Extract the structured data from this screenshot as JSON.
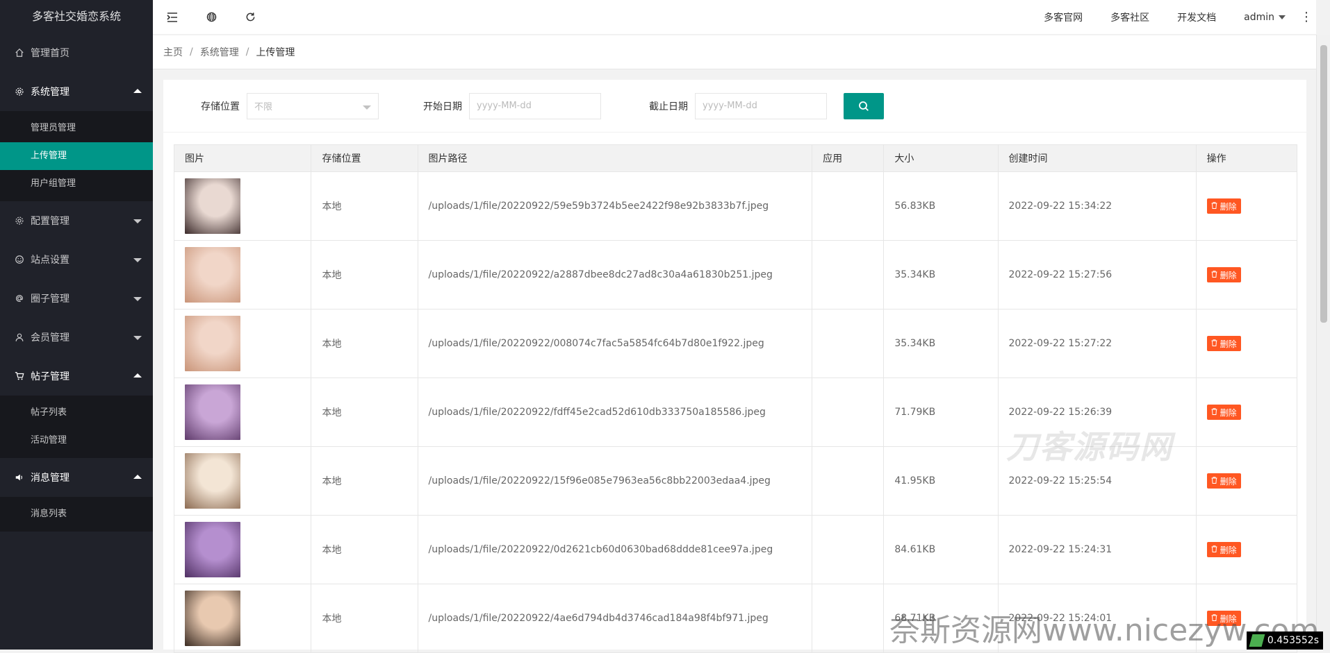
{
  "app": {
    "title": "多客社交婚恋系统"
  },
  "sidebar": {
    "items": [
      {
        "label": "管理首页",
        "icon": "home-icon",
        "expanded": false,
        "has_arrow": false
      },
      {
        "label": "系统管理",
        "icon": "gear-icon",
        "expanded": true,
        "has_arrow": true,
        "children": [
          "管理员管理",
          "上传管理",
          "用户组管理"
        ],
        "active_child": "上传管理"
      },
      {
        "label": "配置管理",
        "icon": "gear-icon",
        "expanded": false,
        "has_arrow": true
      },
      {
        "label": "站点设置",
        "icon": "smile-icon",
        "expanded": false,
        "has_arrow": true
      },
      {
        "label": "圈子管理",
        "icon": "at-icon",
        "expanded": false,
        "has_arrow": true
      },
      {
        "label": "会员管理",
        "icon": "user-icon",
        "expanded": false,
        "has_arrow": true
      },
      {
        "label": "帖子管理",
        "icon": "cart-icon",
        "expanded": true,
        "has_arrow": true,
        "children": [
          "帖子列表",
          "活动管理"
        ]
      },
      {
        "label": "消息管理",
        "icon": "speaker-icon",
        "expanded": true,
        "has_arrow": true,
        "children": [
          "消息列表"
        ]
      }
    ]
  },
  "header": {
    "icons": [
      "menu-fold-icon",
      "globe-icon",
      "refresh-icon"
    ],
    "links": [
      "多客官网",
      "多客社区",
      "开发文档"
    ],
    "user": "admin",
    "more": "⋮"
  },
  "breadcrumb": [
    "主页",
    "系统管理",
    "上传管理"
  ],
  "filters": {
    "storage_label": "存储位置",
    "storage_value": "不限",
    "start_label": "开始日期",
    "start_placeholder": "yyyy-MM-dd",
    "end_label": "截止日期",
    "end_placeholder": "yyyy-MM-dd",
    "search_icon": "search-icon"
  },
  "table": {
    "columns": [
      "图片",
      "存储位置",
      "图片路径",
      "应用",
      "大小",
      "创建时间",
      "操作"
    ],
    "delete_label": "删除",
    "rows": [
      {
        "storage": "本地",
        "path": "/uploads/1/file/20220922/59e59b3724b5ee2422f98e92b3833b7f.jpeg",
        "app": "",
        "size": "56.83KB",
        "created": "2022-09-22 15:34:22",
        "thumb_colors": [
          "#e9d9d2",
          "#3b2a2a"
        ]
      },
      {
        "storage": "本地",
        "path": "/uploads/1/file/20220922/a2887dbee8dc27ad8c30a4a61830b251.jpeg",
        "app": "",
        "size": "35.34KB",
        "created": "2022-09-22 15:27:56",
        "thumb_colors": [
          "#f1d6c8",
          "#c99478"
        ]
      },
      {
        "storage": "本地",
        "path": "/uploads/1/file/20220922/008074c7fac5a5854fc64b7d80e1f922.jpeg",
        "app": "",
        "size": "35.34KB",
        "created": "2022-09-22 15:27:22",
        "thumb_colors": [
          "#f1d6c8",
          "#c99478"
        ]
      },
      {
        "storage": "本地",
        "path": "/uploads/1/file/20220922/fdff45e2cad52d610db333750a185586.jpeg",
        "app": "",
        "size": "71.79KB",
        "created": "2022-09-22 15:26:39",
        "thumb_colors": [
          "#c9a6d6",
          "#5e3a6a"
        ]
      },
      {
        "storage": "本地",
        "path": "/uploads/1/file/20220922/15f96e085e7963ea56c8bb22003edaa4.jpeg",
        "app": "",
        "size": "41.95KB",
        "created": "2022-09-22 15:25:54",
        "thumb_colors": [
          "#f3e5d5",
          "#8c6b52"
        ]
      },
      {
        "storage": "本地",
        "path": "/uploads/1/file/20220922/0d2621cb60d0630bad68ddde81cee97a.jpeg",
        "app": "",
        "size": "84.61KB",
        "created": "2022-09-22 15:24:31",
        "thumb_colors": [
          "#b58fcf",
          "#4f2f62"
        ]
      },
      {
        "storage": "本地",
        "path": "/uploads/1/file/20220922/4ae6d794db4d3746cad184a98f4bf971.jpeg",
        "app": "",
        "size": "68.71KB",
        "created": "2022-09-22 15:24:01",
        "thumb_colors": [
          "#e8c9b0",
          "#3a2b22"
        ]
      }
    ]
  },
  "watermarks": {
    "center": "刀客源码网",
    "bottom": "奈斯资源网www.nicezyw.com",
    "timer": "0.453552s"
  },
  "colors": {
    "accent": "#009688",
    "danger": "#ff5722",
    "sidebar_bg": "#20222a"
  }
}
